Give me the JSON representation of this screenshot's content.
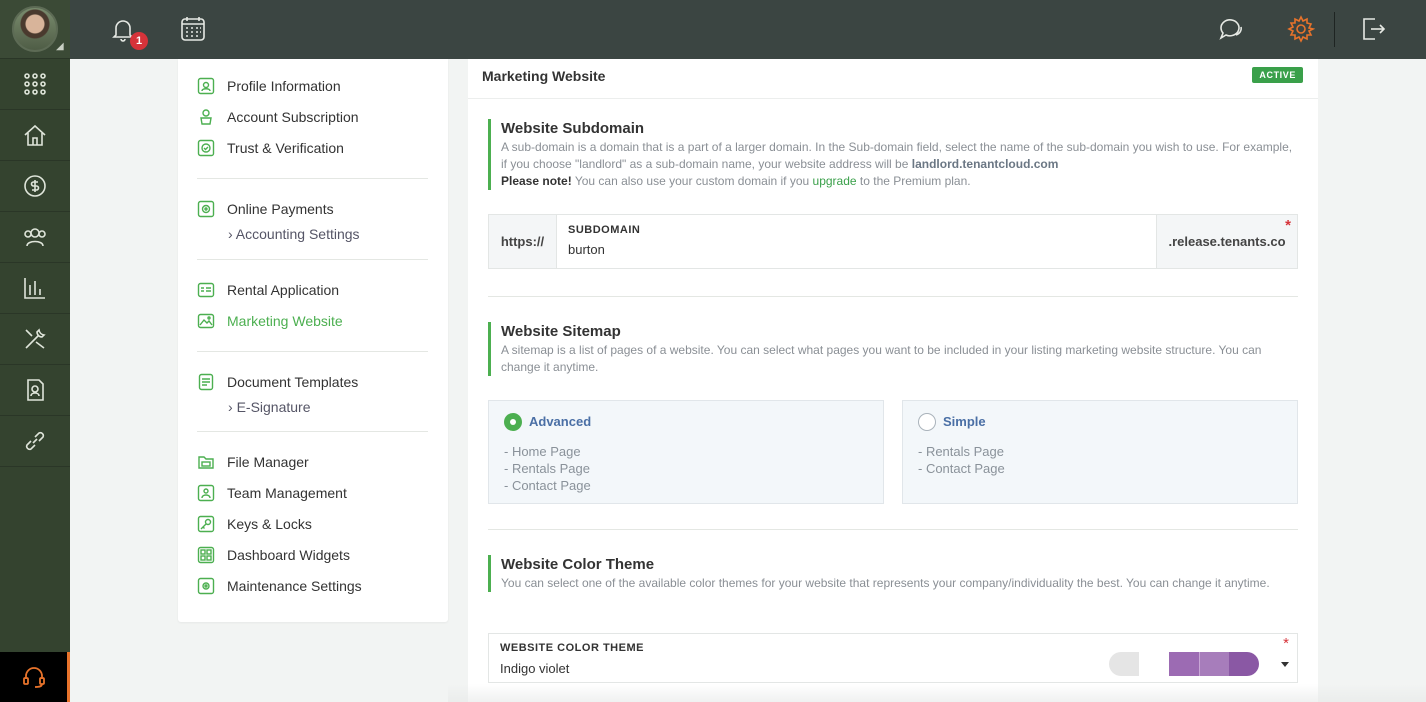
{
  "topbar": {
    "notifications_count": "1",
    "icons": [
      "bell-icon",
      "calendar-icon",
      "chat-icon",
      "gear-icon",
      "logout-icon"
    ],
    "accent": "#e8732b"
  },
  "rail": {
    "items": [
      "apps-grid-icon",
      "properties-icon",
      "payments-icon",
      "tenants-icon",
      "reports-icon",
      "maintenance-icon",
      "documents-icon",
      "links-icon"
    ],
    "support_icon": "headset-icon"
  },
  "settings_nav": {
    "groups": [
      [
        {
          "label": "Profile Information",
          "icon": "profile-icon"
        },
        {
          "label": "Account Subscription",
          "icon": "subscription-icon"
        },
        {
          "label": "Trust & Verification",
          "icon": "verification-icon"
        }
      ],
      [
        {
          "label": "Online Payments",
          "icon": "payments-icon",
          "sub": "Accounting Settings"
        }
      ],
      [
        {
          "label": "Rental Application",
          "icon": "application-icon"
        },
        {
          "label": "Marketing Website",
          "icon": "website-icon",
          "active": true
        }
      ],
      [
        {
          "label": "Document Templates",
          "icon": "templates-icon",
          "sub": "E-Signature"
        }
      ],
      [
        {
          "label": "File Manager",
          "icon": "file-icon"
        },
        {
          "label": "Team Management",
          "icon": "team-icon"
        },
        {
          "label": "Keys & Locks",
          "icon": "keys-icon"
        },
        {
          "label": "Dashboard Widgets",
          "icon": "widgets-icon"
        },
        {
          "label": "Maintenance Settings",
          "icon": "maintenance-icon"
        }
      ]
    ],
    "active_color": "#4caf50"
  },
  "main": {
    "title": "Marketing Website",
    "status_badge": "ACTIVE",
    "subdomain": {
      "heading": "Website Subdomain",
      "desc_part1": "A sub-domain is a domain that is a part of a larger domain. In the Sub-domain field, select the name of the sub-domain you wish to use. For example, if you choose \"landlord\" as a sub-domain name, your website address will be ",
      "desc_domain": "landlord.tenantcloud.com",
      "note_label": "Please note!",
      "note_text1": " You can also use your custom domain if you ",
      "note_link": "upgrade",
      "note_text2": " to the Premium plan.",
      "prefix": "https://",
      "field_label": "SUBDOMAIN",
      "field_value": "burton",
      "suffix": ".release.tenants.co",
      "required_mark": "*"
    },
    "sitemap": {
      "heading": "Website Sitemap",
      "desc": "A sitemap is a list of pages of a website. You can select what pages you want to be included in your listing marketing website structure. You can change it anytime.",
      "options": [
        {
          "label": "Advanced",
          "selected": true,
          "pages": [
            "- Home Page",
            "- Rentals Page",
            "- Contact Page"
          ]
        },
        {
          "label": "Simple",
          "selected": false,
          "pages": [
            "- Rentals Page",
            "- Contact Page"
          ]
        }
      ]
    },
    "color_theme": {
      "heading": "Website Color Theme",
      "desc": "You can select one of the available color themes for your website that represents your company/individuality the best. You can change it anytime.",
      "field_label": "WEBSITE COLOR THEME",
      "field_value": "Indigo violet",
      "required_mark": "*",
      "swatches": [
        "#e5e5e5",
        "#9c6bb3",
        "#a77dbb",
        "#8a58a4"
      ]
    }
  }
}
